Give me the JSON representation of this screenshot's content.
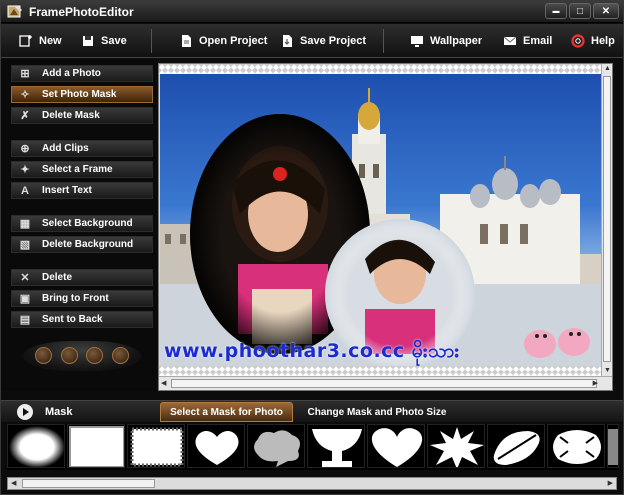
{
  "window": {
    "title": "FramePhotoEditor",
    "minimize": "▬",
    "maximize": "□",
    "close": "✕"
  },
  "toolbar": {
    "new": "New",
    "save": "Save",
    "open_project": "Open Project",
    "save_project": "Save Project",
    "wallpaper": "Wallpaper",
    "email": "Email",
    "help": "Help"
  },
  "sidebar": {
    "items": [
      {
        "label": "Add a Photo",
        "icon": "add-photo-icon",
        "active": false
      },
      {
        "label": "Set Photo Mask",
        "icon": "mask-wand-icon",
        "active": true
      },
      {
        "label": "Delete Mask",
        "icon": "delete-mask-icon",
        "active": false
      },
      {
        "label": "Add Clips",
        "icon": "add-clips-icon",
        "active": false
      },
      {
        "label": "Select a Frame",
        "icon": "frame-wand-icon",
        "active": false
      },
      {
        "label": "Insert Text",
        "icon": "text-icon",
        "active": false
      },
      {
        "label": "Select Background",
        "icon": "background-icon",
        "active": false
      },
      {
        "label": "Delete Background",
        "icon": "delete-background-icon",
        "active": false
      },
      {
        "label": "Delete",
        "icon": "x-icon",
        "active": false
      },
      {
        "label": "Bring to Front",
        "icon": "bring-front-icon",
        "active": false
      },
      {
        "label": "Sent to Back",
        "icon": "send-back-icon",
        "active": false
      }
    ]
  },
  "canvas": {
    "watermark": "www.phoothar3.co.cc မိုးသား"
  },
  "mask_panel": {
    "title": "Mask",
    "tab_active": "Select a Mask for Photo",
    "tab_other": "Change Mask and Photo Size",
    "masks": [
      "ellipse-mask",
      "frame-mask",
      "stamp-mask",
      "heart-round-mask",
      "cloud-mask",
      "goblet-mask",
      "heart-mask",
      "burst-mask",
      "brush-mask",
      "splash-mask"
    ]
  },
  "colors": {
    "active_item": "#8a5a2a",
    "watermark": "#1a2bd0",
    "sky": "#2a62c4"
  }
}
